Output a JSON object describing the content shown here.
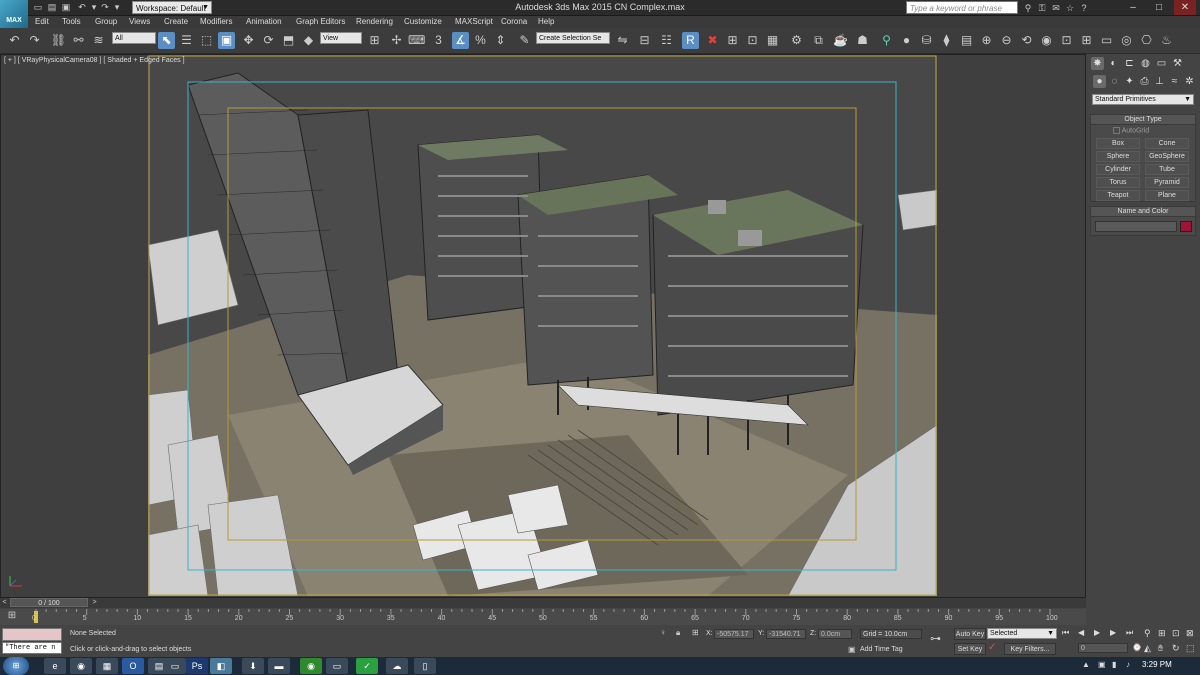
{
  "titlebar": {
    "logo": "MAX",
    "quick_access": [
      "new-icon",
      "open-icon",
      "save-icon",
      "undo-icon",
      "undo-arrow-icon",
      "redo-icon",
      "redo-arrow-icon"
    ],
    "workspace": "Workspace: Default",
    "app_title": "Autodesk 3ds Max  2015    CN Complex.max",
    "search_placeholder": "Type a keyword or phrase",
    "window_buttons": [
      "–",
      "□",
      "✕"
    ]
  },
  "menu": [
    "Edit",
    "Tools",
    "Group",
    "Views",
    "Create",
    "Modifiers",
    "Animation",
    "Graph Editors",
    "Rendering",
    "Customize",
    "MAXScript",
    "Corona",
    "Help"
  ],
  "toolbar": {
    "filter": "All",
    "ref_coord": "View",
    "named_selection": "Create Selection Se"
  },
  "viewport": {
    "label": "[ + ] [ VRayPhysicalCamera08 ] [ Shaded + Edged Faces ]"
  },
  "command_panel": {
    "category": "Standard Primitives",
    "object_type_title": "Object Type",
    "autogrid": "AutoGrid",
    "primitives": [
      "Box",
      "Cone",
      "Sphere",
      "GeoSphere",
      "Cylinder",
      "Tube",
      "Torus",
      "Pyramid",
      "Teapot",
      "Plane"
    ],
    "name_color_title": "Name and Color",
    "object_color": "#a01535"
  },
  "timeline": {
    "frame": "0 / 100",
    "ticks": [
      "0",
      "5",
      "10",
      "15",
      "20",
      "25",
      "30",
      "35",
      "40",
      "45",
      "50",
      "55",
      "60",
      "65",
      "70",
      "75",
      "80",
      "85",
      "90",
      "95",
      "100"
    ]
  },
  "status": {
    "script_text": "\"There are n",
    "selection": "None Selected",
    "prompt": "Click or click-and-drag to select objects",
    "x_label": "X:",
    "x": "-50575.17",
    "y_label": "Y:",
    "y": "-31540.71",
    "z_label": "Z:",
    "z": "0.0cm",
    "grid": "Grid = 10.0cm",
    "add_time_tag": "Add Time Tag",
    "auto_key": "Auto Key",
    "selected_option": "Selected",
    "set_key": "Set Key",
    "key_filters": "Key Filters...",
    "frame_field": "0"
  },
  "taskbar": {
    "clock": "3:29 PM"
  }
}
